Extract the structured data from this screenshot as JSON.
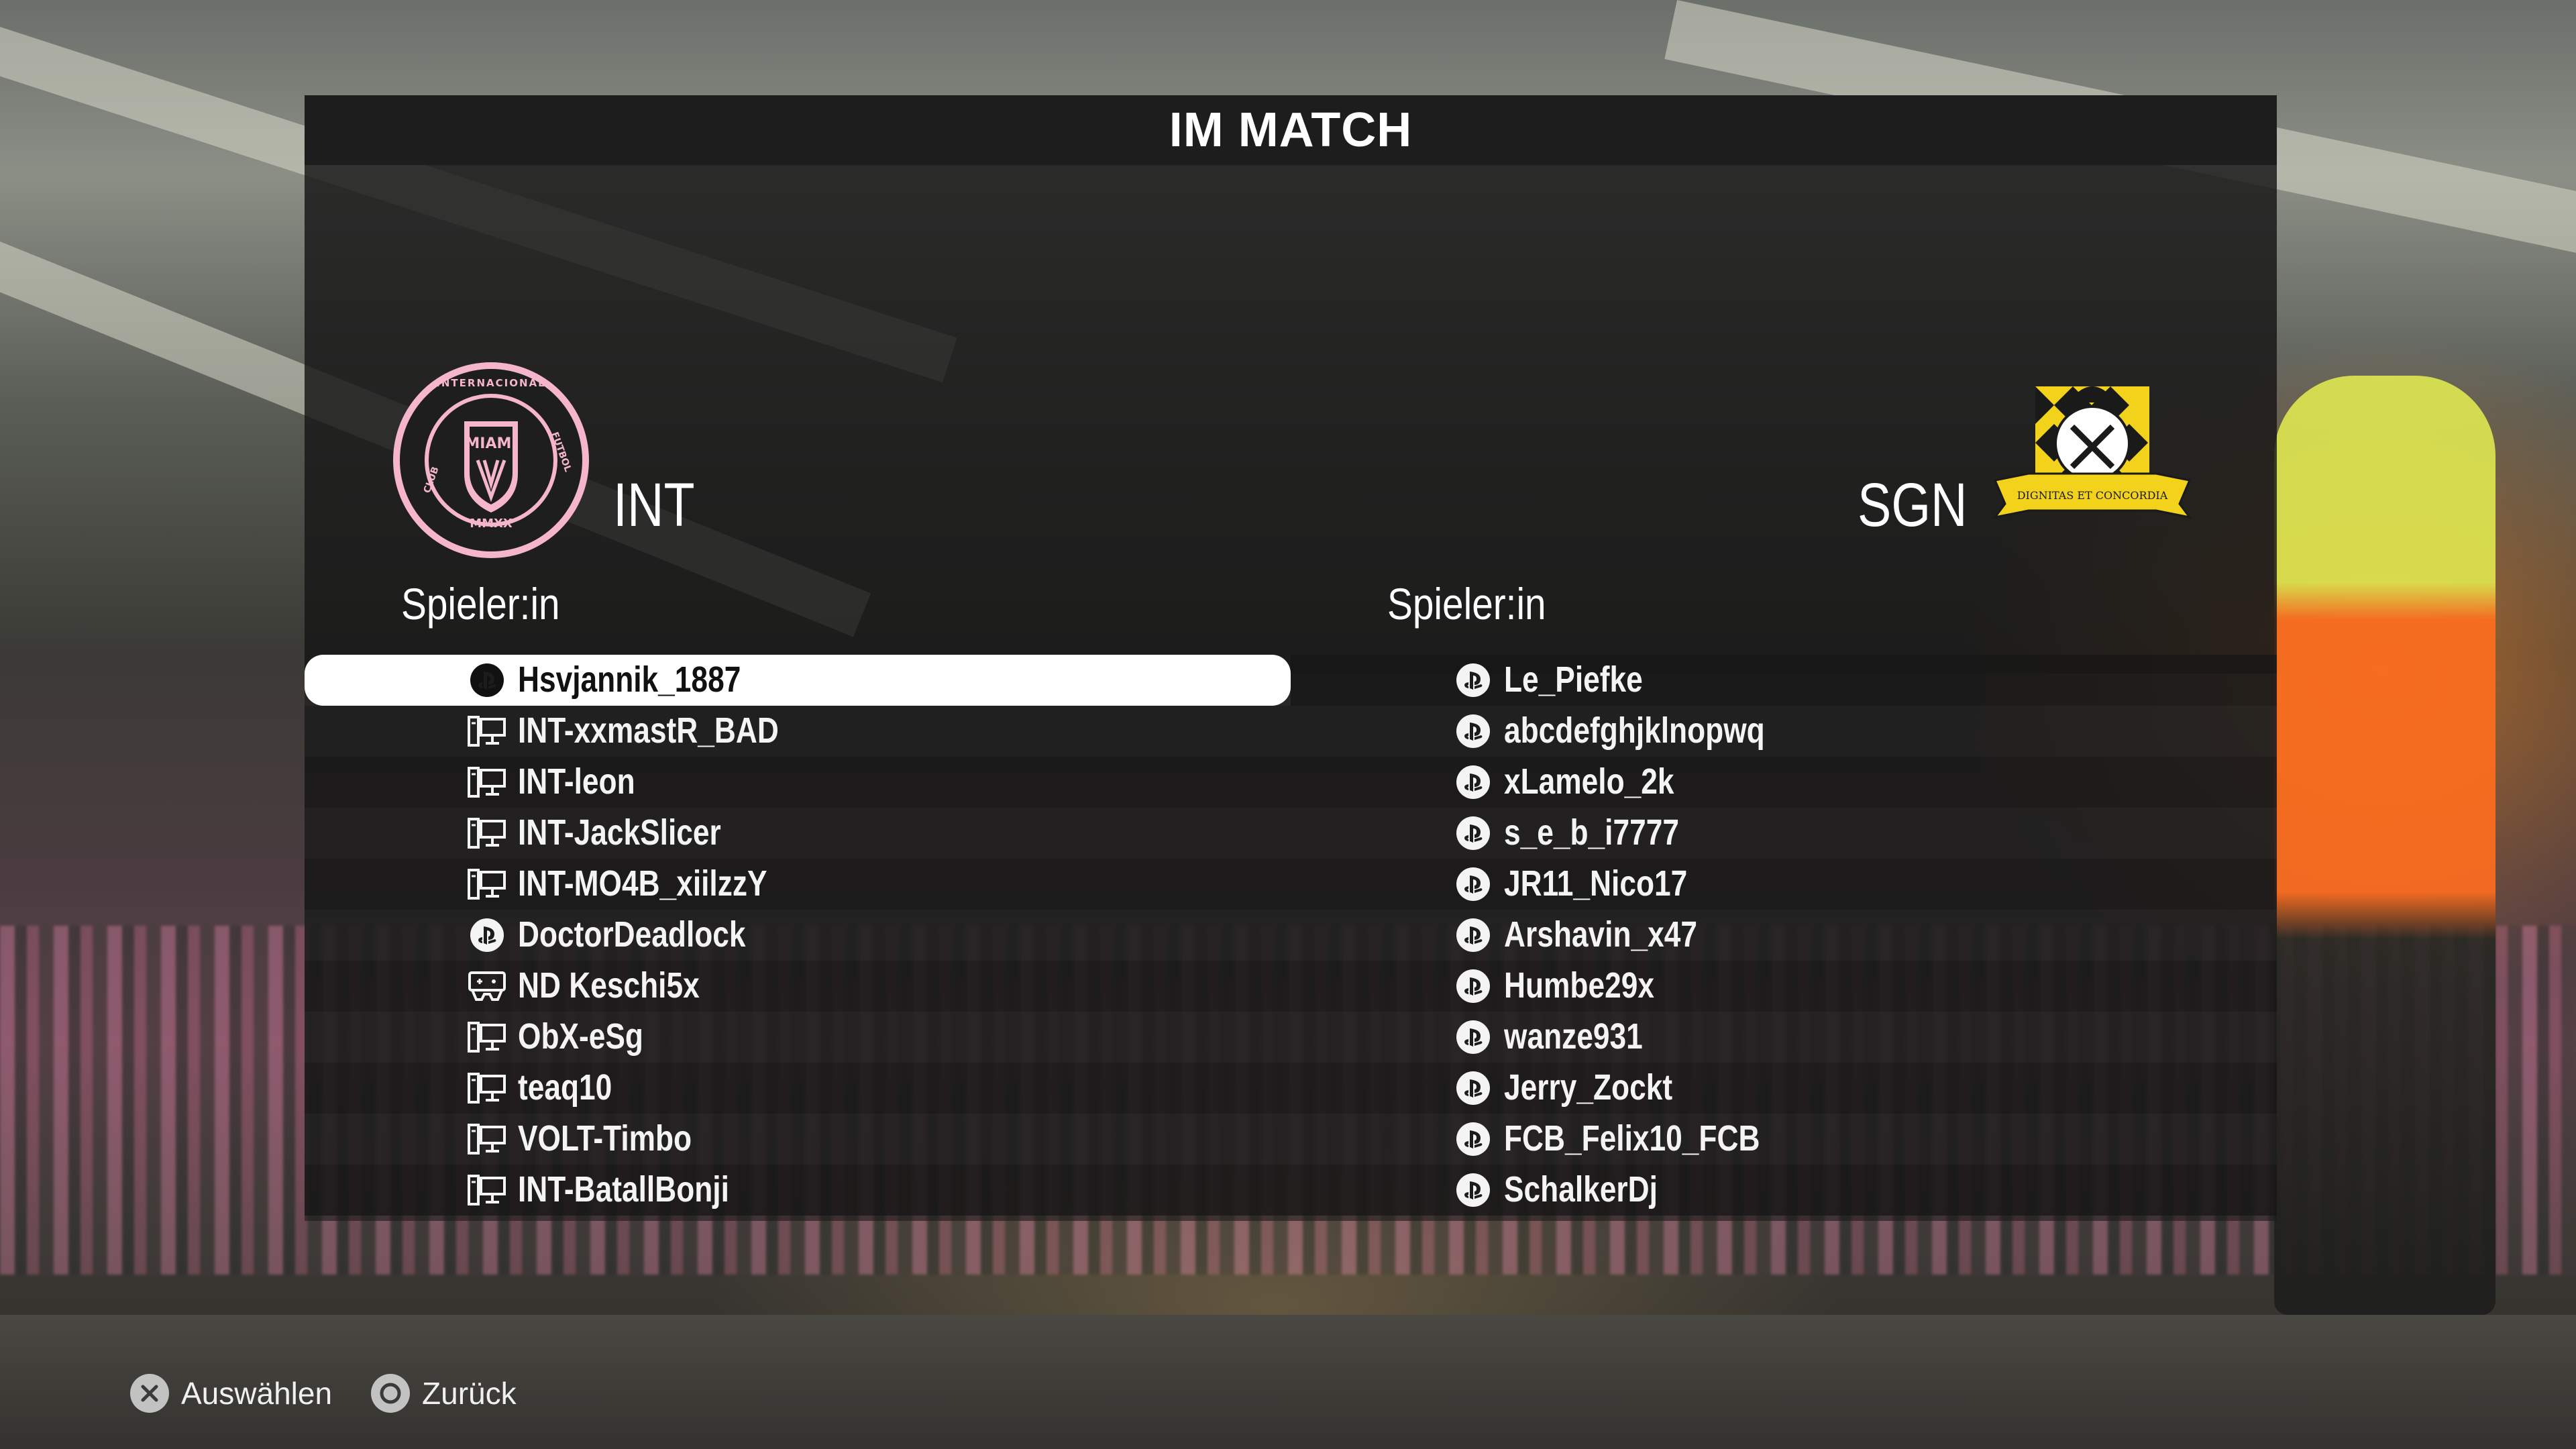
{
  "title": "IM MATCH",
  "home": {
    "code": "INT",
    "crest_text_top": "CLUB INTERNACIONAL DE FUTBOL",
    "crest_text_center": "MIAMI",
    "crest_text_bottom": "MMXX",
    "column_header": "Spieler:in",
    "players": [
      {
        "name": "Hsvjannik_1887",
        "platform": "playstation-icon",
        "selected": true
      },
      {
        "name": "INT-xxmastR_BAD",
        "platform": "pc-icon",
        "selected": false
      },
      {
        "name": "INT-leon",
        "platform": "pc-icon",
        "selected": false
      },
      {
        "name": "INT-JackSlicer",
        "platform": "pc-icon",
        "selected": false
      },
      {
        "name": "INT-MO4B_xiilzzY",
        "platform": "pc-icon",
        "selected": false
      },
      {
        "name": "DoctorDeadlock",
        "platform": "playstation-icon",
        "selected": false
      },
      {
        "name": "ND Keschi5x",
        "platform": "gamepad-icon",
        "selected": false
      },
      {
        "name": "ObX-eSg",
        "platform": "pc-icon",
        "selected": false
      },
      {
        "name": "teaq10",
        "platform": "pc-icon",
        "selected": false
      },
      {
        "name": "VOLT-Timbo",
        "platform": "pc-icon",
        "selected": false
      },
      {
        "name": "INT-BatallBonji",
        "platform": "pc-icon",
        "selected": false
      }
    ]
  },
  "away": {
    "code": "SGN",
    "crest_text": "DIGNITAS ET CONCORDIA",
    "column_header": "Spieler:in",
    "players": [
      {
        "name": "Le_Piefke",
        "platform": "playstation-icon"
      },
      {
        "name": "abcdefghjklnopwq",
        "platform": "playstation-icon"
      },
      {
        "name": "xLamelo_2k",
        "platform": "playstation-icon"
      },
      {
        "name": "s_e_b_i7777",
        "platform": "playstation-icon"
      },
      {
        "name": "JR11_Nico17",
        "platform": "playstation-icon"
      },
      {
        "name": "Arshavin_x47",
        "platform": "playstation-icon"
      },
      {
        "name": "Humbe29x",
        "platform": "playstation-icon"
      },
      {
        "name": "wanze931",
        "platform": "playstation-icon"
      },
      {
        "name": "Jerry_Zockt",
        "platform": "playstation-icon"
      },
      {
        "name": "FCB_Felix10_FCB",
        "platform": "playstation-icon"
      },
      {
        "name": "SchalkerDj",
        "platform": "playstation-icon"
      }
    ]
  },
  "footer": {
    "select_label": "Auswählen",
    "select_icon": "cross-button-icon",
    "back_label": "Zurück",
    "back_icon": "circle-button-icon"
  },
  "colors": {
    "selected_row": "#ffffff",
    "home_crest_pink": "#f5b6cd",
    "away_crest_yellow": "#f2d21b"
  }
}
